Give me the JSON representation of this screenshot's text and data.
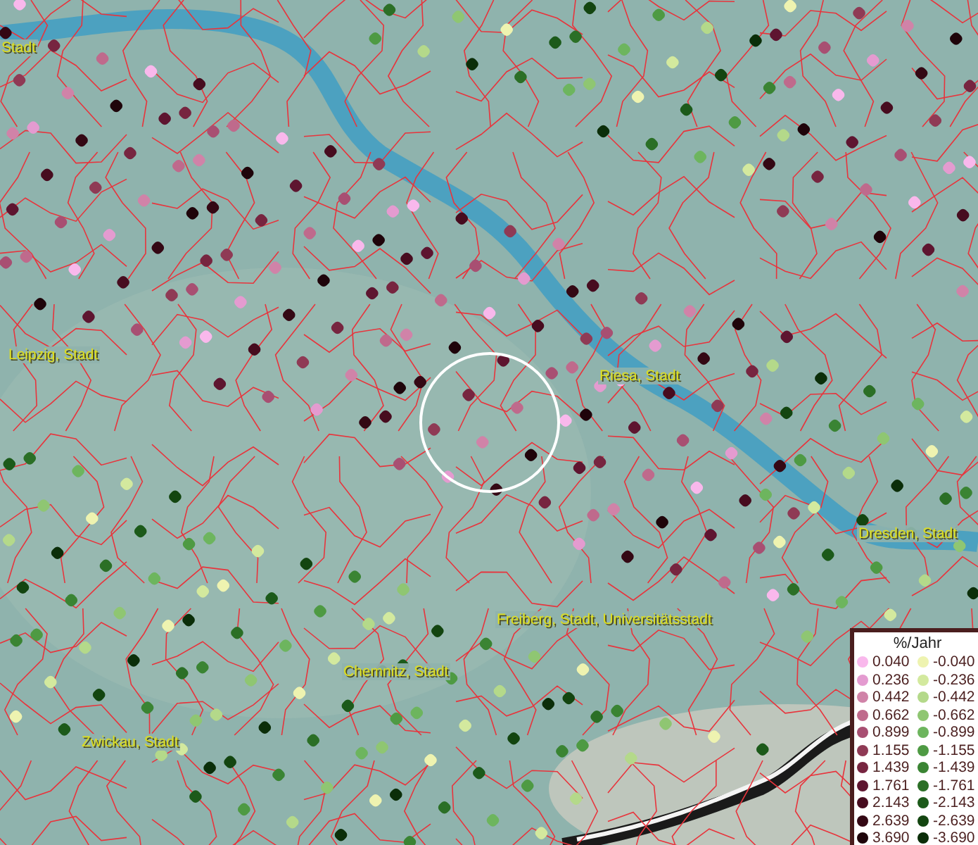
{
  "map": {
    "place_labels": [
      "Stadt",
      "Leipzig, Stadt",
      "Riesa, Stadt",
      "Dresden, Stadt",
      "Freiberg, Stadt, Universitätsstadt",
      "Chemnitz, Stadt",
      "Zwickau, Stadt"
    ]
  },
  "legend": {
    "title": "%/Jahr",
    "rows": [
      {
        "positive": {
          "label": "0.040",
          "color": "#f9b8ec"
        },
        "negative": {
          "label": "-0.040",
          "color": "#eef3b0"
        }
      },
      {
        "positive": {
          "label": "0.236",
          "color": "#e49bd0"
        },
        "negative": {
          "label": "-0.236",
          "color": "#d3e99e"
        }
      },
      {
        "positive": {
          "label": "0.442",
          "color": "#d083a8"
        },
        "negative": {
          "label": "-0.442",
          "color": "#b4d98a"
        }
      },
      {
        "positive": {
          "label": "0.662",
          "color": "#bf6a8c"
        },
        "negative": {
          "label": "-0.662",
          "color": "#8fc672"
        }
      },
      {
        "positive": {
          "label": "0.899",
          "color": "#a84f72"
        },
        "negative": {
          "label": "-0.899",
          "color": "#6db55e"
        }
      },
      {
        "positive": {
          "label": "1.155",
          "color": "#8f3a55"
        },
        "negative": {
          "label": "-1.155",
          "color": "#4e9a43"
        }
      },
      {
        "positive": {
          "label": "1.439",
          "color": "#772540"
        },
        "negative": {
          "label": "-1.439",
          "color": "#3a8433"
        }
      },
      {
        "positive": {
          "label": "1.761",
          "color": "#5e1530"
        },
        "negative": {
          "label": "-1.761",
          "color": "#2b6f26"
        }
      },
      {
        "positive": {
          "label": "2.143",
          "color": "#470c1f"
        },
        "negative": {
          "label": "-2.143",
          "color": "#1c5a1a"
        }
      },
      {
        "positive": {
          "label": "2.639",
          "color": "#340814"
        },
        "negative": {
          "label": "-2.639",
          "color": "#134510"
        }
      },
      {
        "positive": {
          "label": "3.690",
          "color": "#1f040a"
        },
        "negative": {
          "label": "-3.690",
          "color": "#0b2e09"
        }
      }
    ]
  }
}
